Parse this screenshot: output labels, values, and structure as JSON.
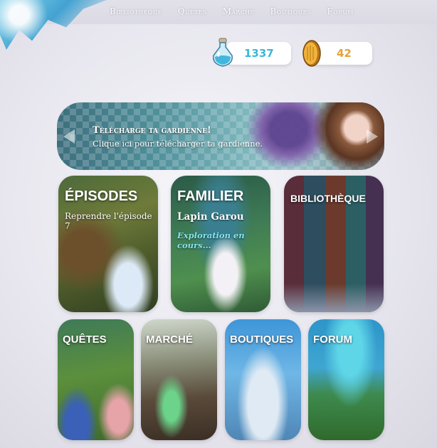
{
  "nav": {
    "items": [
      "Bibliothèque",
      "Quêtes",
      "Marché",
      "Boutiques",
      "Forum"
    ]
  },
  "currency": {
    "potions": "1337",
    "coins": "42"
  },
  "banner": {
    "title": "Télécharge ta gardienne!",
    "subtitle": "Clique ici pour télécharger ta gardienne."
  },
  "tiles": {
    "episodes": {
      "title": "ÉPISODES",
      "subtitle": "Reprendre l'épisode 7"
    },
    "familier": {
      "title": "FAMILIER",
      "name": "Lapin Garou",
      "status": "Exploration en cours..."
    },
    "bibliotheque": {
      "title": "BIBLIOTHÈQUE"
    },
    "quetes": {
      "title": "QUÊTES"
    },
    "marche": {
      "title": "MARCHÉ"
    },
    "boutiques": {
      "title": "BOUTIQUES"
    },
    "forum": {
      "title": "FORUM"
    }
  },
  "colors": {
    "potion_text": "#3ab7d8",
    "coin_text": "#e3a23a",
    "exploration_text": "#7fe6f0"
  }
}
